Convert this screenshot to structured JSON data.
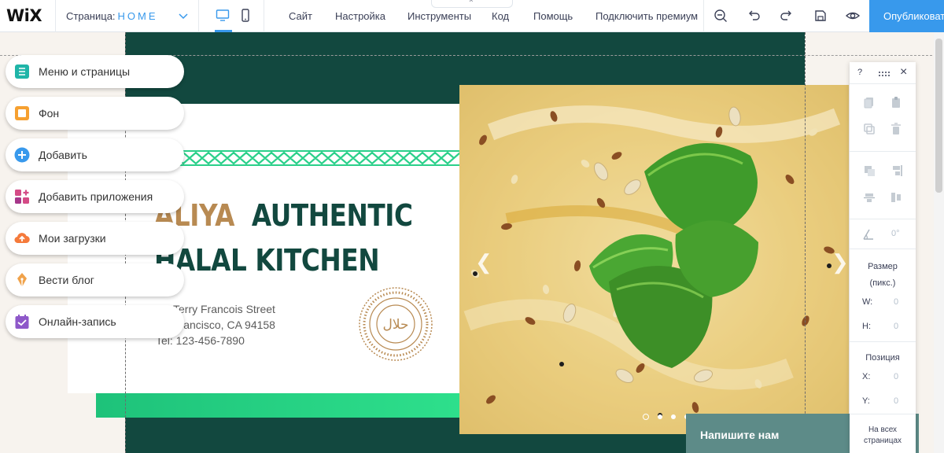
{
  "topbar": {
    "logo": "WiX",
    "page_label": "Страница:",
    "page_name": "HOME",
    "menu": [
      "Сайт",
      "Настройка",
      "Инструменты",
      "Код",
      "Помощь",
      "Подключить премиум"
    ],
    "publish_label": "Опубликоват",
    "tab_chevron": "^"
  },
  "left_panel": {
    "items": [
      {
        "label": "Меню и страницы",
        "icon": "pages-icon",
        "color": "#1fb5a8"
      },
      {
        "label": "Фон",
        "icon": "background-icon",
        "color": "#f6a030"
      },
      {
        "label": "Добавить",
        "icon": "add-icon",
        "color": "#3899ec"
      },
      {
        "label": "Добавить приложения",
        "icon": "apps-icon",
        "color": "#d44b86"
      },
      {
        "label": "Мои загрузки",
        "icon": "uploads-icon",
        "color": "#f57a3b"
      },
      {
        "label": "Вести блог",
        "icon": "blog-icon",
        "color": "#f0a24a"
      },
      {
        "label": "Онлайн-запись",
        "icon": "booking-icon",
        "color": "#8e58c9"
      }
    ]
  },
  "site": {
    "title_part1": "ALIYA",
    "title_part2": "AUTHENTIC",
    "title_line2": "HALAL KITCHEN",
    "address_line1": "Terry Francois Street",
    "address_line2": "Francisco, CA 94158",
    "phone": "Tel: 123-456-7890",
    "seal_text": "حلال",
    "chat_label": "Напишите нам",
    "slide_count": 4,
    "slide_active": 1
  },
  "right_panel": {
    "help": "?",
    "close": "×",
    "angle_value": "0°",
    "size_title": "Размер",
    "size_unit": "(пикс.)",
    "w_label": "W:",
    "w_value": "0",
    "h_label": "H:",
    "h_value": "0",
    "pos_title": "Позиция",
    "x_label": "X:",
    "x_value": "0",
    "y_label": "Y:",
    "y_value": "0",
    "all_pages_1": "На всех",
    "all_pages_2": "страницах"
  },
  "colors": {
    "accent": "#3899ec",
    "dark_green": "#12483f",
    "bright_green": "#1ec27a",
    "gold": "#b88a52",
    "chat_bg": "#5d8b88"
  }
}
